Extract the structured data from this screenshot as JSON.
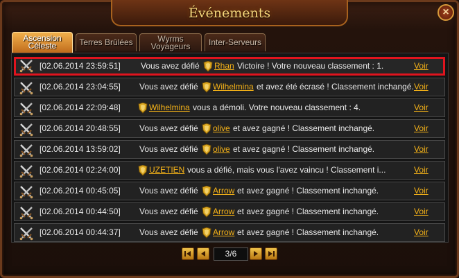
{
  "window": {
    "title": "Événements",
    "close_label": "×"
  },
  "tabs": [
    {
      "line1": "Ascension",
      "line2": "Céleste"
    },
    {
      "line1": "Terres Brûlées",
      "line2": ""
    },
    {
      "line1": "Wyrms",
      "line2": "Voyageurs"
    },
    {
      "line1": "Inter-Serveurs",
      "line2": ""
    }
  ],
  "events": [
    {
      "date": "[02.06.2014 23:59:51]",
      "prefix": "Vous avez défié",
      "name": "Rhan",
      "suffix": "Victoire ! Votre nouveau classement : 1.",
      "action": "Voir",
      "highlighted": true
    },
    {
      "date": "[02.06.2014 23:04:55]",
      "prefix": "Vous avez défié",
      "name": "Wilhelmina",
      "suffix": "et avez été écrasé ! Classement inchangé.",
      "action": "Voir"
    },
    {
      "date": "[02.06.2014 22:09:48]",
      "prefix": "",
      "name": "Wilhelmina",
      "suffix": "vous a démoli. Votre nouveau classement : 4.",
      "action": "Voir"
    },
    {
      "date": "[02.06.2014 20:48:55]",
      "prefix": "Vous avez défié",
      "name": "olive",
      "suffix": "et avez gagné ! Classement inchangé.",
      "action": "Voir"
    },
    {
      "date": "[02.06.2014 13:59:02]",
      "prefix": "Vous avez défié",
      "name": "olive",
      "suffix": "et avez gagné ! Classement inchangé.",
      "action": "Voir"
    },
    {
      "date": "[02.06.2014 02:24:00]",
      "prefix": "",
      "name": "UZETIEN",
      "suffix": "vous a défié, mais vous l'avez vaincu ! Classement i...",
      "action": "Voir"
    },
    {
      "date": "[02.06.2014 00:45:05]",
      "prefix": "Vous avez défié",
      "name": "Arrow",
      "suffix": "et avez gagné ! Classement inchangé.",
      "action": "Voir"
    },
    {
      "date": "[02.06.2014 00:44:50]",
      "prefix": "Vous avez défié",
      "name": "Arrow",
      "suffix": "et avez gagné ! Classement inchangé.",
      "action": "Voir"
    },
    {
      "date": "[02.06.2014 00:44:37]",
      "prefix": "Vous avez défié",
      "name": "Arrow",
      "suffix": "et avez gagné ! Classement inchangé.",
      "action": "Voir"
    }
  ],
  "pagination": {
    "current": "3/6"
  },
  "colors": {
    "accent": "#f6b318",
    "highlight": "#e0141e",
    "title": "#f7d67a"
  },
  "icons": {
    "row": "crossed-swords-icon",
    "player": "shield-icon"
  }
}
